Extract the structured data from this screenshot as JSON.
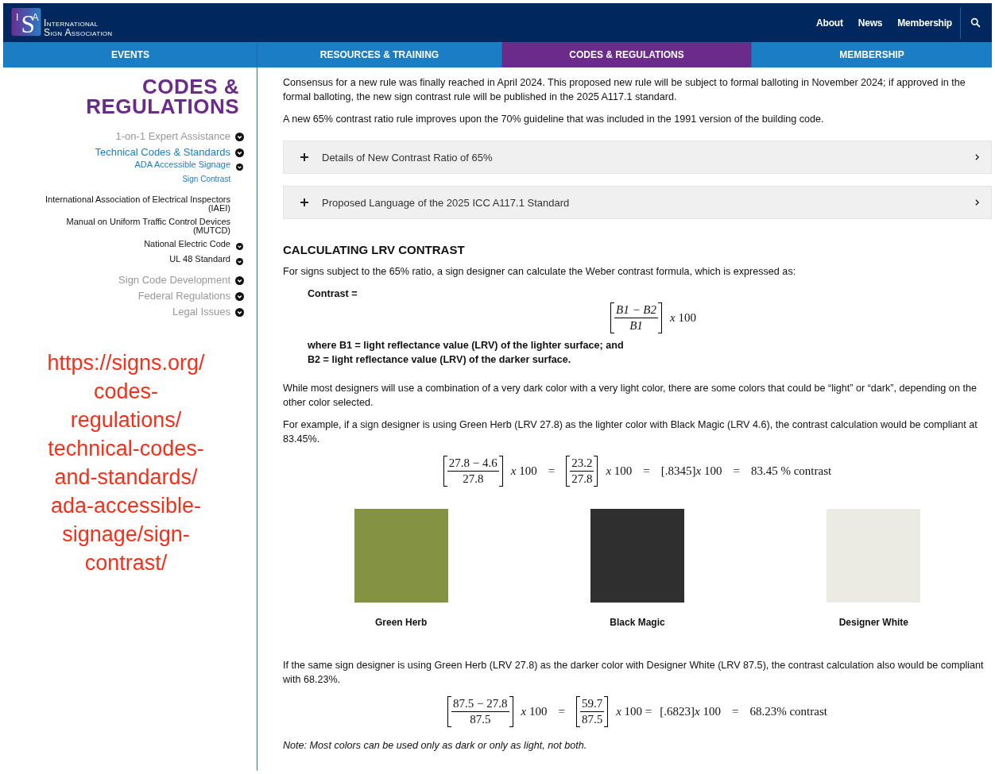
{
  "logo": {
    "letters": [
      "I",
      "S",
      "A"
    ],
    "line_1": "International",
    "line_2": "Sign Association"
  },
  "top_links": [
    "About",
    "News",
    "Membership"
  ],
  "tabs": [
    {
      "label": "EVENTS",
      "selected": false
    },
    {
      "label": "RESOURCES & TRAINING",
      "selected": false
    },
    {
      "label": "CODES & REGULATIONS",
      "selected": true
    },
    {
      "label": "MEMBERSHIP",
      "selected": false
    }
  ],
  "sidebar": {
    "title": "CODES & REGULATIONS",
    "items": [
      {
        "label": "1-on-1 Expert Assistance",
        "active": false,
        "toggle": true
      },
      {
        "label": "Technical Codes & Standards",
        "active": true,
        "toggle": true,
        "children": [
          {
            "label": "ADA Accessible Signage",
            "active": true,
            "toggle": true,
            "children": [
              {
                "label": "Sign Contrast",
                "active": true,
                "toggle": false
              }
            ]
          },
          {
            "label": "International Association of Electrical Inspectors (IAEI)",
            "active": false,
            "toggle": false
          },
          {
            "label": "Manual on Uniform Traffic Control Devices (MUTCD)",
            "active": false,
            "toggle": false
          },
          {
            "label": "National Electric Code",
            "active": false,
            "toggle": true
          },
          {
            "label": "UL 48 Standard",
            "active": false,
            "toggle": true
          }
        ]
      },
      {
        "label": "Sign Code Development",
        "active": false,
        "toggle": true
      },
      {
        "label": "Federal Regulations",
        "active": false,
        "toggle": true
      },
      {
        "label": "Legal Issues",
        "active": false,
        "toggle": true
      }
    ],
    "annotation_lines": [
      "https://signs.org/",
      "codes-",
      "regulations/",
      "technical-codes-",
      "and-standards/",
      "ada-accessible-",
      "signage/sign-",
      "contrast/"
    ]
  },
  "intro": [
    "Consensus for a new rule was finally reached in April 2024. This proposed new rule will be subject to formal balloting in November 2024; if approved in the formal balloting, the new sign contrast rule will be published in the 2025 A117.1 standard.",
    "A new 65% contrast ratio rule improves upon the 70% guideline that was included in the 1991 version of the building code."
  ],
  "accordions": [
    {
      "label": "Details of New Contrast Ratio of 65%",
      "expanded": false
    },
    {
      "label": "Proposed Language of the 2025 ICC A117.1 Standard",
      "expanded": false
    }
  ],
  "heading": "CALCULATING LRV CONTRAST",
  "lead": "For signs subject to the 65% ratio, a sign designer can calculate the Weber contrast formula, which is expressed as:",
  "contrast_label": "Contrast =",
  "formula_main": [
    {
      "kind": "fraction",
      "numerator": "B1 − B2",
      "denominator": "B1",
      "italic": true
    },
    {
      "kind": "text",
      "text": "*x* 100"
    }
  ],
  "definitions": [
    "where B1 = light reflectance value (LRV) of the lighter surface; and",
    "B2 = light reflectance value (LRV) of the darker surface."
  ],
  "para_1": "While most designers will use a combination of a very dark color with a very light color, there are some colors that could be “light” or “dark”, depending on the other color selected.",
  "para_2": "For example, if a sign designer is using Green Herb (LRV 27.8) as the lighter color with Black Magic (LRV 4.6), the contrast calculation would be compliant at 83.45%.",
  "formula_1": [
    {
      "kind": "fraction",
      "numerator": "27.8 − 4.6",
      "denominator": "27.8",
      "italic": false
    },
    {
      "kind": "text",
      "text": "*x* 100"
    },
    {
      "kind": "op",
      "text": "="
    },
    {
      "kind": "fraction",
      "numerator": "23.2",
      "denominator": "27.8",
      "italic": false
    },
    {
      "kind": "text",
      "text": "*x* 100"
    },
    {
      "kind": "op",
      "text": "="
    },
    {
      "kind": "text",
      "text": "[.8345]*x* 100"
    },
    {
      "kind": "op",
      "text": "="
    },
    {
      "kind": "text",
      "text": "83.45 % contrast"
    }
  ],
  "swatches": [
    {
      "label": "Green Herb",
      "color": "#849343"
    },
    {
      "label": "Black Magic",
      "color": "#2f2f2f"
    },
    {
      "label": "Designer White",
      "color": "#ecebe3"
    }
  ],
  "para_3": "If the same sign designer is using Green Herb (LRV 27.8) as the darker color with Designer White (LRV 87.5), the contrast calculation also would be compliant with 68.23%.",
  "formula_2": [
    {
      "kind": "fraction",
      "numerator": "87.5 − 27.8",
      "denominator": "87.5",
      "italic": false
    },
    {
      "kind": "text",
      "text": "*x* 100"
    },
    {
      "kind": "op",
      "text": "="
    },
    {
      "kind": "fraction",
      "numerator": "59.7",
      "denominator": "87.5",
      "italic": false
    },
    {
      "kind": "text",
      "text": "*x* 100 ="
    },
    {
      "kind": "text",
      "text": "[.6823]*x* 100"
    },
    {
      "kind": "op",
      "text": "="
    },
    {
      "kind": "text",
      "text": "68.23% contrast"
    }
  ],
  "note": "Note: Most colors can be used only as dark or only as light, not both."
}
